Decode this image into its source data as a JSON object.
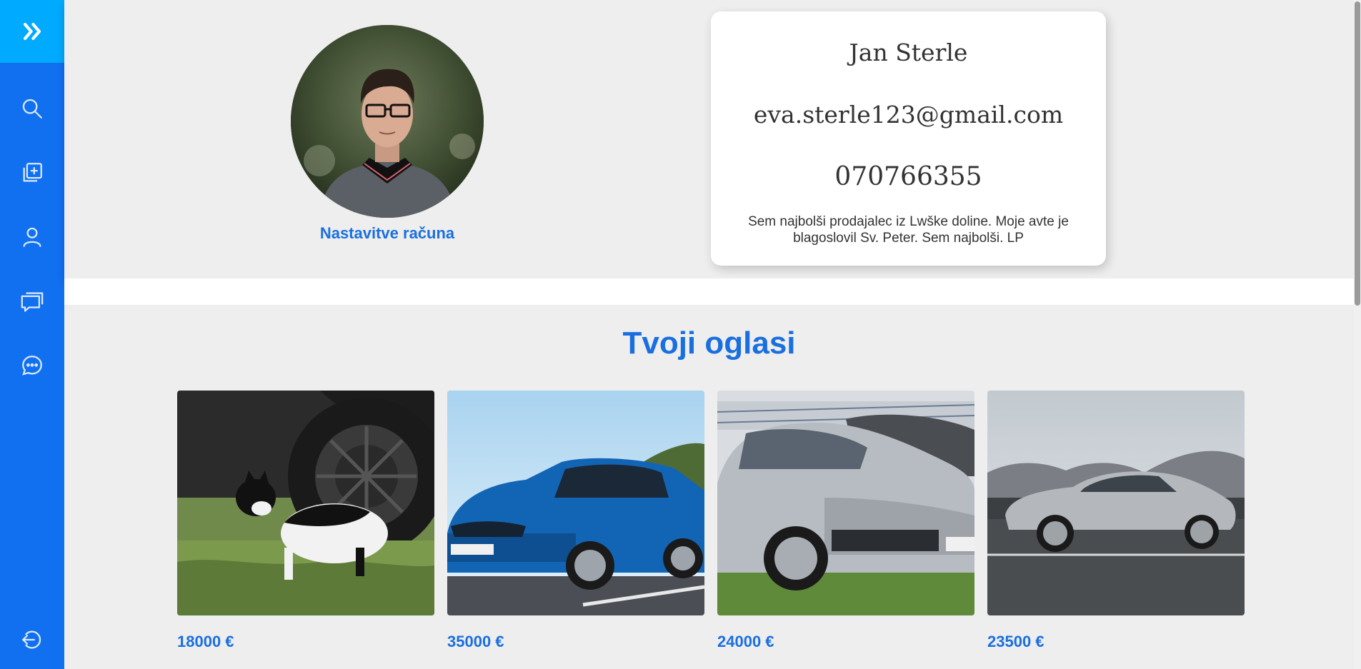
{
  "sidebar": {
    "toggle_icon": "double-chevron-right-icon",
    "items": [
      {
        "icon": "search-icon"
      },
      {
        "icon": "add-listing-icon"
      },
      {
        "icon": "user-icon"
      },
      {
        "icon": "messages-icon"
      },
      {
        "icon": "chat-icon"
      }
    ],
    "logout_icon": "logout-icon"
  },
  "profile": {
    "account_settings_label": "Nastavitve računa",
    "name": "Jan Sterle",
    "email": "eva.sterle123@gmail.com",
    "phone": "070766355",
    "bio": "Sem najbolši prodajalec iz Lwške doline. Moje avte je blagoslovil Sv. Peter. Sem najbolši. LP"
  },
  "ads": {
    "title": "Tvoji oglasi",
    "items": [
      {
        "price": "18000 €"
      },
      {
        "price": "35000 €"
      },
      {
        "price": "24000 €"
      },
      {
        "price": "23500 €"
      }
    ]
  },
  "colors": {
    "sidebar": "#1170f0",
    "sidebar_toggle": "#00aaff",
    "accent": "#1a6fe0"
  }
}
